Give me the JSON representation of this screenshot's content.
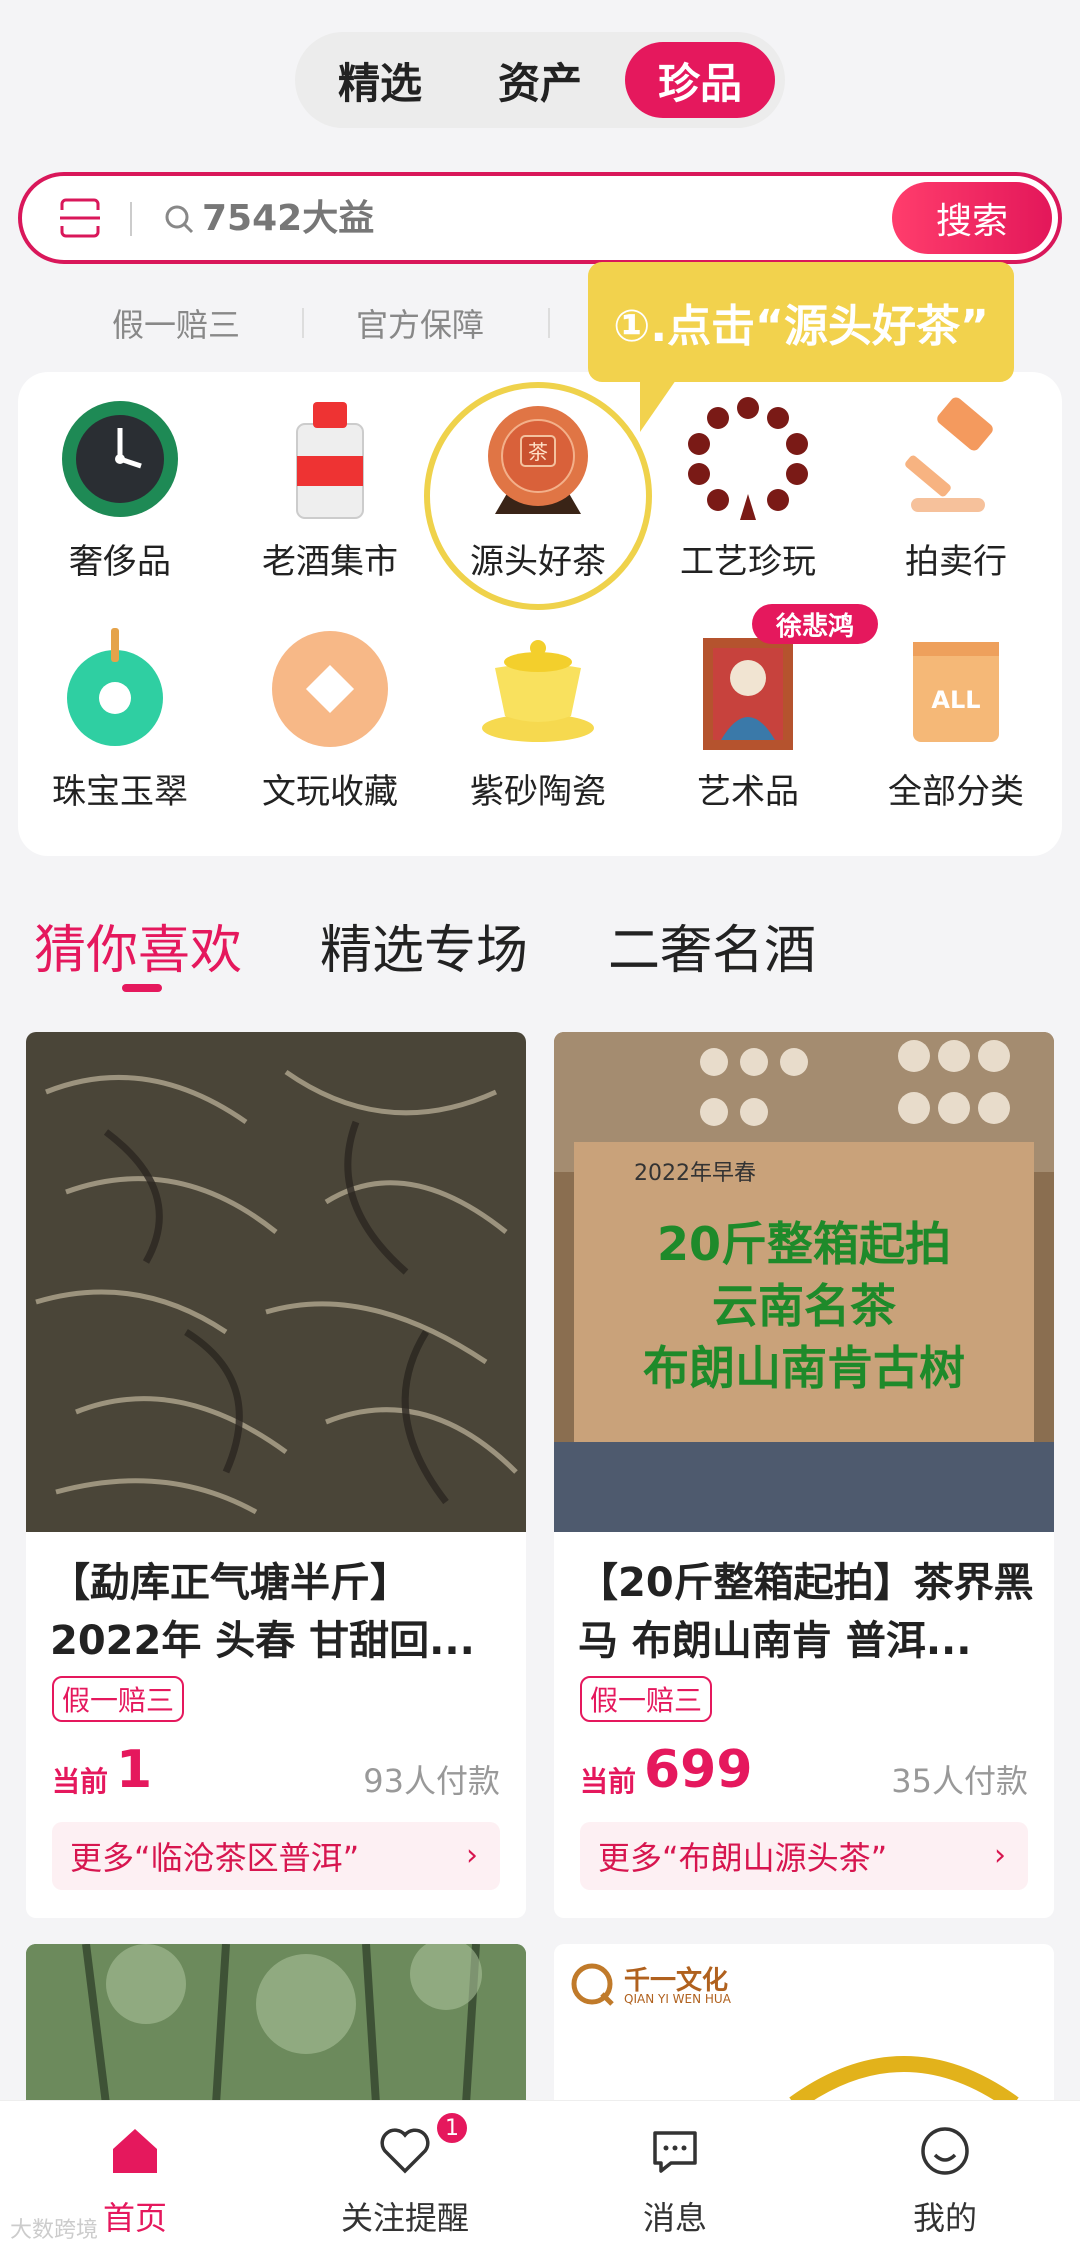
{
  "top_tabs": [
    "精选",
    "资产",
    "珍品"
  ],
  "active_top_tab": 2,
  "search": {
    "value": "7542大益",
    "button": "搜索"
  },
  "guarantees": [
    "假一赔三",
    "官方保障"
  ],
  "tooltip": "①.点击“源头好茶”",
  "categories": [
    {
      "label": "奢侈品",
      "icon": "watch-icon"
    },
    {
      "label": "老酒集市",
      "icon": "liquor-bottle-icon"
    },
    {
      "label": "源头好茶",
      "icon": "tea-cake-icon"
    },
    {
      "label": "工艺珍玩",
      "icon": "bead-bracelet-icon"
    },
    {
      "label": "拍卖行",
      "icon": "gavel-icon"
    },
    {
      "label": "珠宝玉翠",
      "icon": "jade-ring-icon"
    },
    {
      "label": "文玩收藏",
      "icon": "coin-icon"
    },
    {
      "label": "紫砂陶瓷",
      "icon": "teacup-icon"
    },
    {
      "label": "艺术品",
      "icon": "painting-icon"
    },
    {
      "label": "全部分类",
      "icon": "box-icon"
    }
  ],
  "art_badge": "徐悲鸿",
  "feed_tabs": [
    "猜你喜欢",
    "精选专场",
    "二奢名酒"
  ],
  "products": [
    {
      "title": "【勐库正气塘半斤】2022年 头春 甘甜回...",
      "tag": "假一赔三",
      "price_prefix": "当前",
      "price": "1",
      "payers": "93人付款",
      "more": "更多“临沧茶区普洱”"
    },
    {
      "title": "【20斤整箱起拍】茶界黑马 布朗山南肯 普洱...",
      "tag": "假一赔三",
      "price_prefix": "当前",
      "price": "699",
      "payers": "35人付款",
      "more": "更多“布朗山源头茶”",
      "image_text": [
        "2022年早春",
        "20斤整箱起拍",
        "云南名茶",
        "布朗山南肯古树"
      ]
    }
  ],
  "brand_logo": {
    "name": "千一文化",
    "sub": "QIAN YI WEN HUA"
  },
  "nav": [
    {
      "label": "首页",
      "icon": "home-icon"
    },
    {
      "label": "关注提醒",
      "icon": "heart-icon",
      "badge": "1"
    },
    {
      "label": "消息",
      "icon": "message-icon"
    },
    {
      "label": "我的",
      "icon": "profile-icon"
    }
  ],
  "watermark": "大数跨境",
  "colors": {
    "accent": "#e5185d",
    "tooltip": "#f2d24d"
  }
}
